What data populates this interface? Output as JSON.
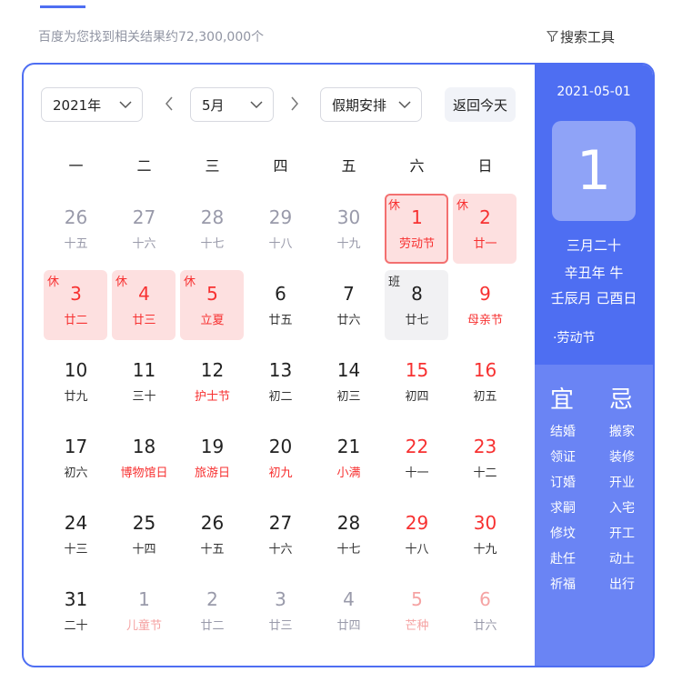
{
  "search": {
    "result_count": "百度为您找到相关结果约72,300,000个",
    "tools_label": "搜索工具"
  },
  "controls": {
    "year": "2021年",
    "month": "5月",
    "holiday": "假期安排",
    "today": "返回今天"
  },
  "weekdays": [
    "一",
    "二",
    "三",
    "四",
    "五",
    "六",
    "日"
  ],
  "weeks": [
    [
      {
        "day": "26",
        "sub": "十五",
        "other": true
      },
      {
        "day": "27",
        "sub": "十六",
        "other": true
      },
      {
        "day": "28",
        "sub": "十七",
        "other": true
      },
      {
        "day": "29",
        "sub": "十八",
        "other": true
      },
      {
        "day": "30",
        "sub": "十九",
        "other": true
      },
      {
        "day": "1",
        "sub": "劳动节",
        "tag": "休",
        "rest": true,
        "selected": true
      },
      {
        "day": "2",
        "sub": "廿一",
        "tag": "休",
        "rest": true
      }
    ],
    [
      {
        "day": "3",
        "sub": "廿二",
        "tag": "休",
        "rest": true
      },
      {
        "day": "4",
        "sub": "廿三",
        "tag": "休",
        "rest": true
      },
      {
        "day": "5",
        "sub": "立夏",
        "tag": "休",
        "rest": true
      },
      {
        "day": "6",
        "sub": "廿五"
      },
      {
        "day": "7",
        "sub": "廿六"
      },
      {
        "day": "8",
        "sub": "廿七",
        "tag": "班",
        "work": true
      },
      {
        "day": "9",
        "sub": "母亲节",
        "weekend": true,
        "festival": true
      }
    ],
    [
      {
        "day": "10",
        "sub": "廿九"
      },
      {
        "day": "11",
        "sub": "三十"
      },
      {
        "day": "12",
        "sub": "护士节",
        "festival": true
      },
      {
        "day": "13",
        "sub": "初二"
      },
      {
        "day": "14",
        "sub": "初三"
      },
      {
        "day": "15",
        "sub": "初四",
        "weekend": true
      },
      {
        "day": "16",
        "sub": "初五",
        "weekend": true
      }
    ],
    [
      {
        "day": "17",
        "sub": "初六"
      },
      {
        "day": "18",
        "sub": "博物馆日",
        "festival": true
      },
      {
        "day": "19",
        "sub": "旅游日",
        "festival": true
      },
      {
        "day": "20",
        "sub": "初九",
        "festival": true
      },
      {
        "day": "21",
        "sub": "小满",
        "festival": true
      },
      {
        "day": "22",
        "sub": "十一",
        "weekend": true
      },
      {
        "day": "23",
        "sub": "十二",
        "weekend": true
      }
    ],
    [
      {
        "day": "24",
        "sub": "十三"
      },
      {
        "day": "25",
        "sub": "十四"
      },
      {
        "day": "26",
        "sub": "十五"
      },
      {
        "day": "27",
        "sub": "十六"
      },
      {
        "day": "28",
        "sub": "十七"
      },
      {
        "day": "29",
        "sub": "十八",
        "weekend": true
      },
      {
        "day": "30",
        "sub": "十九",
        "weekend": true
      }
    ],
    [
      {
        "day": "31",
        "sub": "二十"
      },
      {
        "day": "1",
        "sub": "儿童节",
        "other": true,
        "festival": true
      },
      {
        "day": "2",
        "sub": "廿二",
        "other": true
      },
      {
        "day": "3",
        "sub": "廿三",
        "other": true
      },
      {
        "day": "4",
        "sub": "廿四",
        "other": true
      },
      {
        "day": "5",
        "sub": "芒种",
        "other": true,
        "weekend": true,
        "festival": true
      },
      {
        "day": "6",
        "sub": "廿六",
        "other": true,
        "weekend": true
      }
    ]
  ],
  "side": {
    "date": "2021-05-01",
    "day": "1",
    "lunar": "三月二十",
    "ganzhi_year": "辛丑年 牛",
    "ganzhi_month_day": "壬辰月 己酉日",
    "festival": "·劳动节",
    "yi_label": "宜",
    "ji_label": "忌",
    "yi": [
      "结婚",
      "领证",
      "订婚",
      "求嗣",
      "修坟",
      "赴任",
      "祈福"
    ],
    "ji": [
      "搬家",
      "装修",
      "开业",
      "入宅",
      "开工",
      "动土",
      "出行"
    ]
  },
  "colors": {
    "accent": "#4e6ef2",
    "holiday_bg": "#fde0e0",
    "red": "#f73131"
  },
  "icons": {
    "filter": "filter-icon",
    "dropdown": "chevron-down-icon",
    "prev": "chevron-left-icon",
    "next": "chevron-right-icon"
  }
}
